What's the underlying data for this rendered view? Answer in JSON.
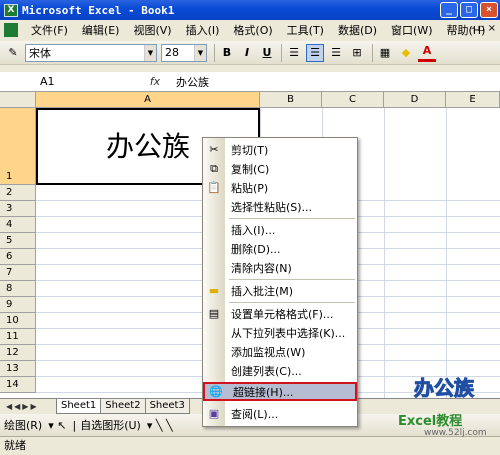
{
  "window": {
    "title": "Microsoft Excel - Book1",
    "app_icon": "excel-icon"
  },
  "menubar": {
    "items": [
      "文件(F)",
      "编辑(E)",
      "视图(V)",
      "插入(I)",
      "格式(O)",
      "工具(T)",
      "数据(D)",
      "窗口(W)",
      "帮助(H)"
    ]
  },
  "toolbar": {
    "font_name": "宋体",
    "font_size": "28",
    "bold": "B",
    "italic": "I",
    "underline": "U",
    "font_color_label": "A"
  },
  "formula_bar": {
    "name_box": "A1",
    "fx_label": "fx",
    "value": "办公族"
  },
  "grid": {
    "columns": [
      "A",
      "B",
      "C",
      "D",
      "E"
    ],
    "rows": [
      "1",
      "2",
      "3",
      "4",
      "5",
      "6",
      "7",
      "8",
      "9",
      "10",
      "11",
      "12",
      "13",
      "14"
    ],
    "cell_a1": "办公族"
  },
  "context_menu": {
    "items": [
      {
        "label": "剪切(T)",
        "icon": "scissors-icon"
      },
      {
        "label": "复制(C)",
        "icon": "copy-icon"
      },
      {
        "label": "粘贴(P)",
        "icon": "paste-icon"
      },
      {
        "label": "选择性粘贴(S)...",
        "icon": ""
      },
      {
        "label": "插入(I)...",
        "icon": ""
      },
      {
        "label": "删除(D)...",
        "icon": ""
      },
      {
        "label": "清除内容(N)",
        "icon": ""
      },
      {
        "label": "插入批注(M)",
        "icon": "comment-icon"
      },
      {
        "label": "设置单元格格式(F)...",
        "icon": "format-cells-icon"
      },
      {
        "label": "从下拉列表中选择(K)...",
        "icon": ""
      },
      {
        "label": "添加监视点(W)",
        "icon": ""
      },
      {
        "label": "创建列表(C)...",
        "icon": ""
      },
      {
        "label": "超链接(H)...",
        "icon": "globe-link-icon"
      },
      {
        "label": "查阅(L)...",
        "icon": "research-icon"
      }
    ],
    "highlighted_index": 12
  },
  "sheet_tabs": {
    "tabs": [
      "Sheet1",
      "Sheet2",
      "Sheet3"
    ],
    "active": 0
  },
  "draw_toolbar": {
    "draw_label": "绘图(R)",
    "autoshape_label": "自选图形(U)"
  },
  "status": {
    "text": "就绪"
  },
  "watermark": {
    "line1": "办公族",
    "line2": "Excel教程",
    "line3": "www.52lj.com"
  }
}
